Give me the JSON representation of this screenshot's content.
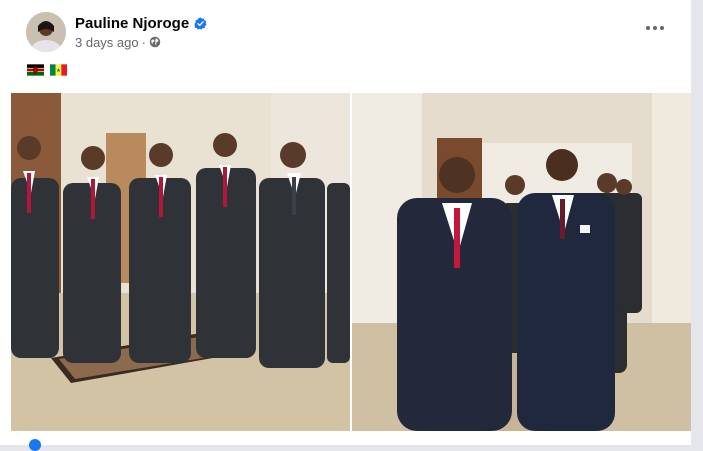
{
  "post": {
    "author_name": "Pauline Njoroge",
    "timestamp": "3 days ago",
    "separator": "·",
    "verified_icon": "verified-badge-icon",
    "audience_icon": "globe-icon",
    "more_icon": "more-options-icon"
  },
  "caption": {
    "flags": [
      "kenya-flag",
      "senegal-flag"
    ]
  },
  "colors": {
    "verified_blue": "#1877f2",
    "name_text": "#050505",
    "secondary_text": "#65676b"
  }
}
